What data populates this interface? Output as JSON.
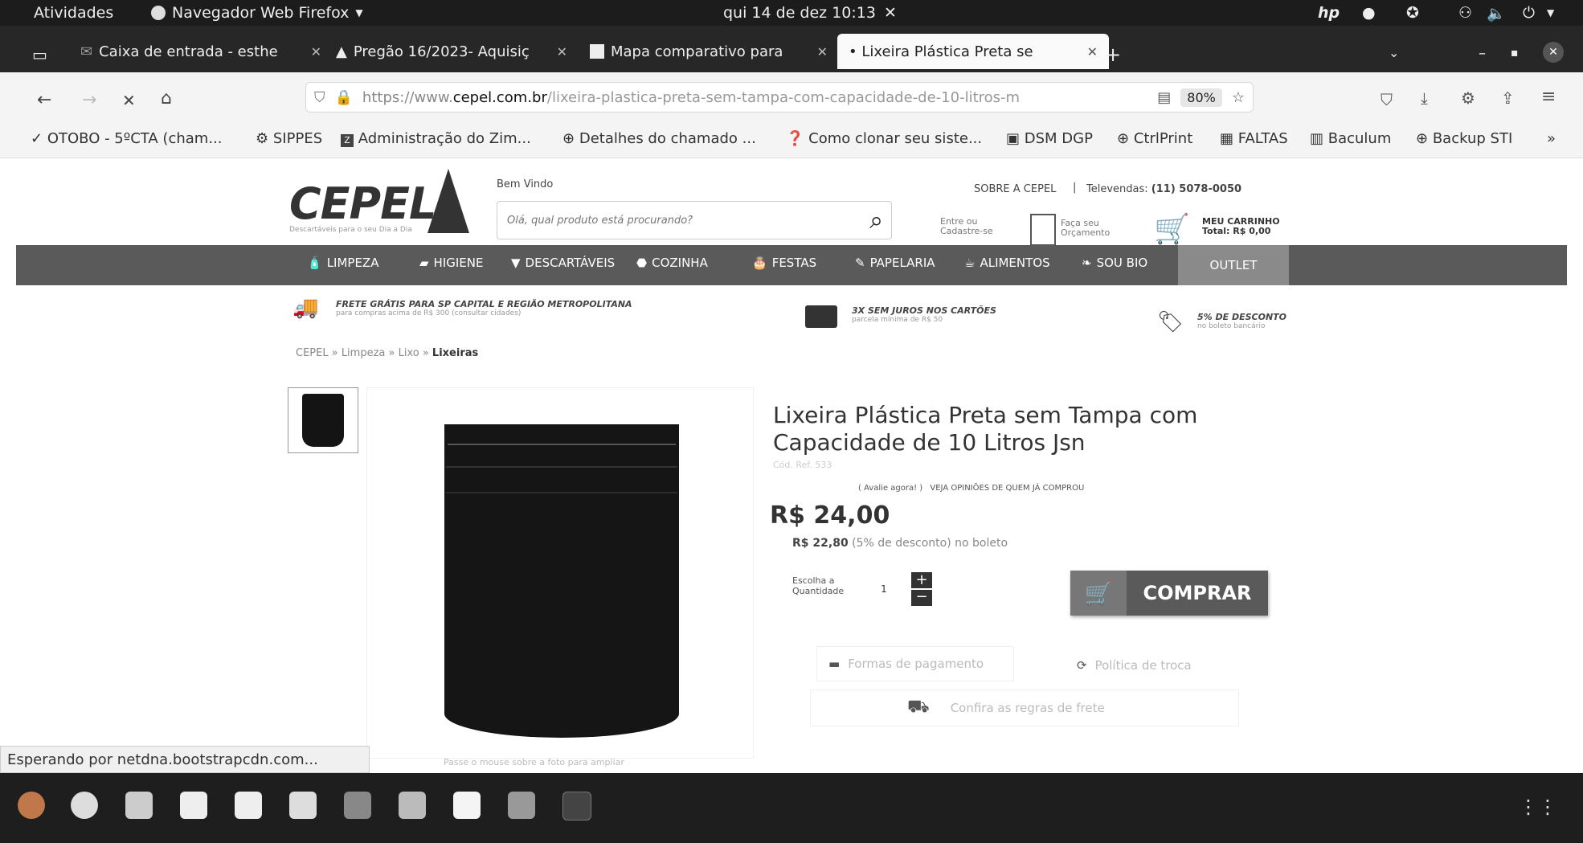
{
  "system": {
    "activities": "Atividades",
    "app_menu": "Navegador Web Firefox",
    "datetime": "qui 14 de dez  10:13"
  },
  "tabs": [
    {
      "title": "Caixa de entrada - esthe"
    },
    {
      "title": "Pregão 16/2023- Aquisiç"
    },
    {
      "title": "Mapa comparativo para"
    },
    {
      "title": "• Lixeira Plástica Preta se"
    }
  ],
  "navbar": {
    "url_prefix": "https://www.",
    "url_domain": "cepel.com.br",
    "url_path": "/lixeira-plastica-preta-sem-tampa-com-capacidade-de-10-litros-m",
    "zoom": "80%"
  },
  "bookmarks": [
    "OTOBO - 5ºCTA (cham...",
    "SIPPES",
    "Administração do Zim...",
    "Detalhes do chamado ...",
    "Como clonar seu siste...",
    "DSM DGP",
    "CtrlPrint",
    "FALTAS",
    "Baculum",
    "Backup STI"
  ],
  "site": {
    "logo_text": "CEPEL",
    "logo_tagline": "Descartáveis para o seu Dia a Dia",
    "welcome": "Bem Vindo",
    "search_placeholder": "Olá, qual produto está procurando?",
    "about": "SOBRE A CEPEL",
    "televendas_label": "Televendas:",
    "televendas_phone": "(11) 5078-0050",
    "login_text": "Entre ou Cadastre-se",
    "quote_text": "Faça seu Orçamento",
    "cart_title": "MEU CARRINHO",
    "cart_total": "Total: R$ 0,00",
    "categories": [
      "LIMPEZA",
      "HIGIENE",
      "DESCARTÁVEIS",
      "COZINHA",
      "FESTAS",
      "PAPELARIA",
      "ALIMENTOS",
      "SOU BIO",
      "OUTLET"
    ],
    "promos": [
      {
        "title": "FRETE GRÁTIS PARA SP CAPITAL E REGIÃO METROPOLITANA",
        "sub": "para compras acima de R$ 300 (consultar cidades)"
      },
      {
        "title": "3X SEM JUROS NOS CARTÕES",
        "sub": "parcela mínima de R$ 50"
      },
      {
        "title": "5% DE DESCONTO",
        "sub": "no boleto bancário"
      }
    ],
    "breadcrumb": [
      "CEPEL",
      "Limpeza",
      "Lixo",
      "Lixeiras"
    ]
  },
  "product": {
    "title_line1": "Lixeira Plástica Preta sem Tampa com",
    "title_line2": "Capacidade de 10 Litros Jsn",
    "ref": "Cód. Ref. 533",
    "rate_link": "( Avalie agora! )",
    "reviews_link": "VEJA OPINIÕES DE QUEM JÁ COMPROU",
    "price": "R$ 24,00",
    "boleto_price": "R$ 22,80",
    "boleto_note": "(5% de desconto) no boleto",
    "qty_label": "Escolha a Quantidade",
    "qty_value": "1",
    "buy_label": "COMPRAR",
    "payment_link": "Formas de pagamento",
    "exchange_link": "Política de troca",
    "shipping_link": "Confira as regras de frete",
    "zoom_hint": "Passe o mouse sobre a foto para ampliar"
  },
  "status_text": "Esperando por netdna.bootstrapcdn.com..."
}
